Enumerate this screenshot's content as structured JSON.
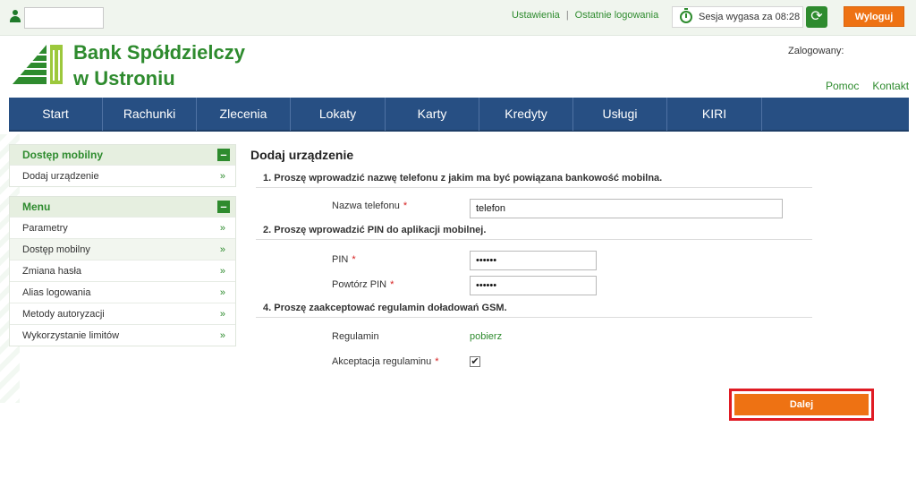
{
  "topbar": {
    "username_value": "",
    "links": [
      "Ustawienia",
      "Ostatnie logowania"
    ],
    "separator": "|",
    "session_text": "Sesja wygasa za 08:28",
    "logout_label": "Wyloguj"
  },
  "header": {
    "bank_name_line1": "Bank Spółdzielczy",
    "bank_name_line2": "w Ustroniu",
    "logged_in_label": "Zalogowany:",
    "help_link": "Pomoc",
    "contact_link": "Kontakt"
  },
  "nav": {
    "items": [
      "Start",
      "Rachunki",
      "Zlecenia",
      "Lokaty",
      "Karty",
      "Kredyty",
      "Usługi",
      "KIRI"
    ]
  },
  "sidebar": {
    "mobile_panel": {
      "title": "Dostęp mobilny",
      "toggle": "–",
      "items": [
        "Dodaj urządzenie"
      ]
    },
    "menu_panel": {
      "title": "Menu",
      "toggle": "–",
      "items": [
        "Parametry",
        "Dostęp mobilny",
        "Zmiana hasła",
        "Alias logowania",
        "Metody autoryzacji",
        "Wykorzystanie limitów"
      ]
    },
    "arrow_glyph": "»"
  },
  "main": {
    "title": "Dodaj urządzenie",
    "step1": "1. Proszę wprowadzić nazwę telefonu z jakim ma być powiązana bankowość mobilna.",
    "phone_name_label": "Nazwa telefonu",
    "phone_name_value": "telefon",
    "step2": "2. Proszę wprowadzić PIN do aplikacji mobilnej.",
    "pin_label": "PIN",
    "pin_value": "••••••",
    "pin_repeat_label": "Powtórz PIN",
    "pin_repeat_value": "••••••",
    "step4": "4. Proszę zaakceptować regulamin doładowań GSM.",
    "terms_label": "Regulamin",
    "terms_link": "pobierz",
    "accept_label": "Akceptacja regulaminu",
    "accept_checked": "✔",
    "required_mark": "*",
    "next_label": "Dalej"
  },
  "colors": {
    "brand_green": "#2e8b2e",
    "nav_blue": "#274f83",
    "accent_orange": "#ee7213",
    "highlight_red": "#e01b24"
  }
}
